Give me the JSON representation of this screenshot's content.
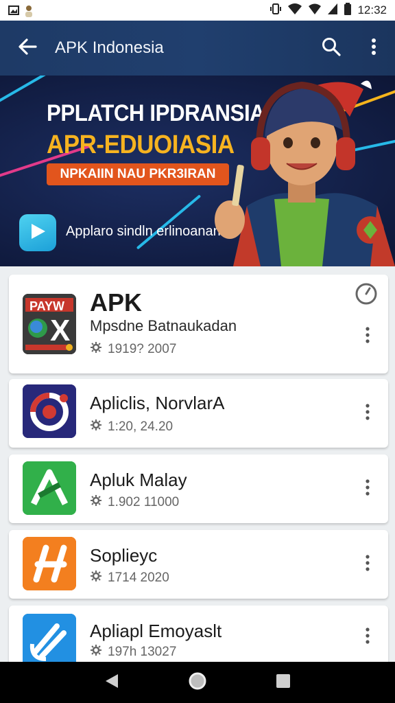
{
  "status": {
    "time": "12:32"
  },
  "app_bar": {
    "title": "APK Indonesia",
    "color": "#1e3a66"
  },
  "banner": {
    "headline": "PPLATCH IPDRANSIA",
    "subheadline": "APR-EDUOIASIA",
    "pill": "NPKAIIN NAU PKR3IRAN",
    "caption": "Applaro sindln erlinoanan"
  },
  "apps": [
    {
      "title": "APK",
      "subtitle": "Mpsdne Batnaukadan",
      "meta": "1919? 2007",
      "icon": "apk-x-icon"
    },
    {
      "title": "Apliclis, NorvlarA",
      "meta": "1:20, 24.20",
      "icon": "target-icon"
    },
    {
      "title": "Apluk Malay",
      "meta": "1.902 11000",
      "icon": "a-logo-icon"
    },
    {
      "title": "Soplieyc",
      "meta": "1714 2020",
      "icon": "h-logo-icon"
    },
    {
      "title": "Apliapl Emoyaslt",
      "meta": "197h 13027",
      "icon": "swoosh-icon"
    }
  ]
}
